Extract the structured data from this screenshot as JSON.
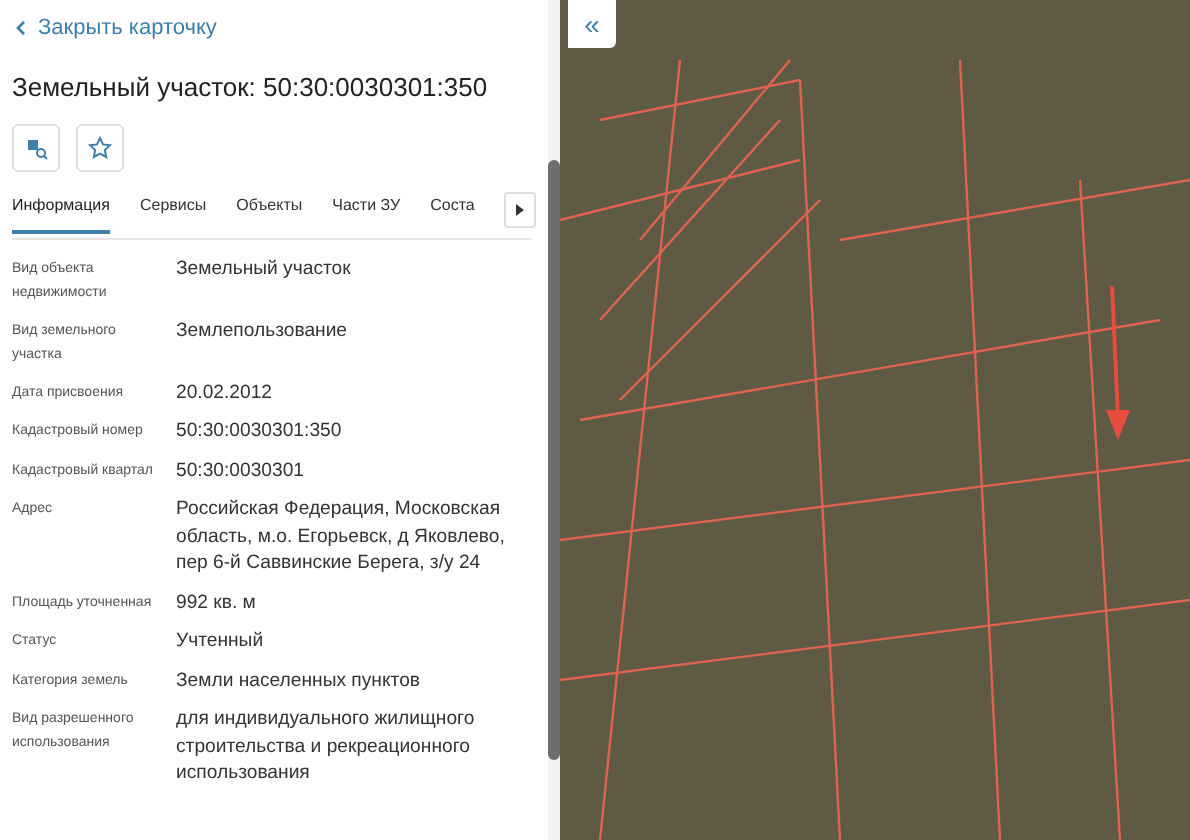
{
  "panel": {
    "back_link": "Закрыть карточку",
    "title": "Земельный участок: 50:30:0030301:350",
    "tabs": [
      {
        "label": "Информация",
        "selected": true
      },
      {
        "label": "Сервисы",
        "selected": false
      },
      {
        "label": "Объекты",
        "selected": false
      },
      {
        "label": "Части ЗУ",
        "selected": false
      },
      {
        "label": "Соста",
        "selected": false
      }
    ],
    "properties": [
      {
        "label": "Вид объекта недвижимости",
        "value": "Земельный участок"
      },
      {
        "label": "Вид земельного участка",
        "value": "Землепользование"
      },
      {
        "label": "Дата присвоения",
        "value": "20.02.2012"
      },
      {
        "label": "Кадастровый номер",
        "value": "50:30:0030301:350"
      },
      {
        "label": "Кадастровый квартал",
        "value": "50:30:0030301"
      },
      {
        "label": "Адрес",
        "value": "Российская Федерация, Московская область, м.о. Егорьевск, д Яковлево, пер 6-й Саввинские Берега, з/у 24"
      },
      {
        "label": "Площадь уточненная",
        "value": "992 кв. м"
      },
      {
        "label": "Статус",
        "value": "Учтенный"
      },
      {
        "label": "Категория земель",
        "value": "Земли населенных пунктов"
      },
      {
        "label": "Вид разрешенного использования",
        "value": "для индивидуального жилищного строительства и рекреационного использования"
      }
    ]
  },
  "map": {
    "collapse_button": "«"
  }
}
